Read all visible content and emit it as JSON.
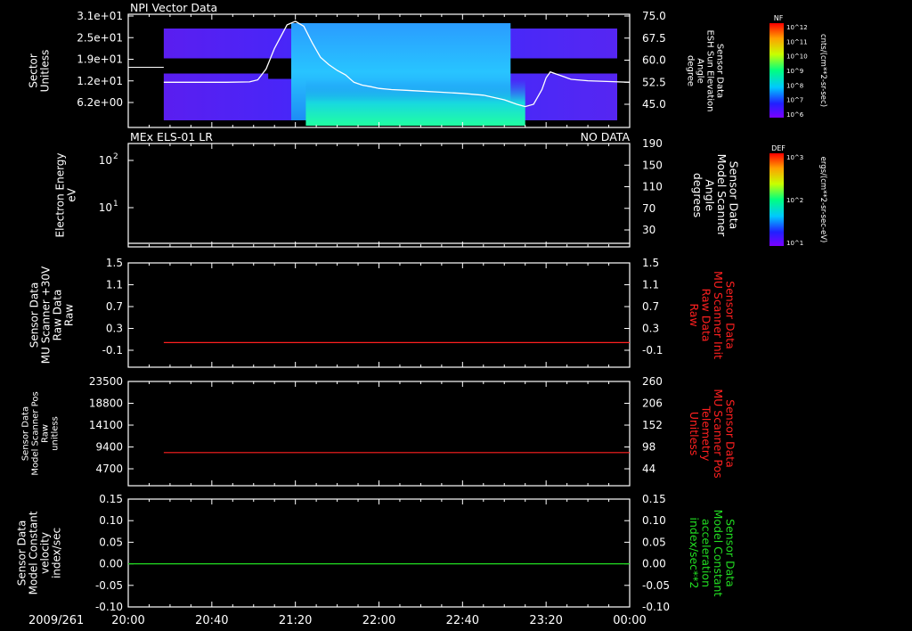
{
  "colors": {
    "background": "#000000",
    "foreground": "#ffffff",
    "red": "#ff2020",
    "green": "#22dd22"
  },
  "time_axis": {
    "date": "2009/261",
    "ticks": [
      "20:00",
      "20:40",
      "21:20",
      "22:00",
      "22:40",
      "23:20",
      "00:00"
    ],
    "minutes": [
      0,
      40,
      80,
      120,
      160,
      200,
      240
    ]
  },
  "colorbars": [
    {
      "title": "NF",
      "unit": "cnts/(cm**2-sr-sec)",
      "ticks": [
        "10^12",
        "10^11",
        "10^10",
        "10^9",
        "10^8",
        "10^7",
        "10^6"
      ]
    },
    {
      "title": "DEF",
      "unit": "ergs/(cm**2-sr-sec-eV)",
      "ticks": [
        "10^3",
        "10^2",
        "10^1"
      ]
    }
  ],
  "chart_data": [
    {
      "type": "heatmap",
      "title": "NPI Vector Data",
      "ylabel_lines": [
        "Sector",
        "Unitless"
      ],
      "yticks": [
        "3.1e+01",
        "2.5e+01",
        "1.9e+01",
        "1.2e+01",
        "6.2e+00"
      ],
      "right_ylabel_lines": [
        "Sensor Data",
        "ESH Sun Elevation",
        "Angle",
        "degree"
      ],
      "right_yticks": [
        "75.0",
        "67.5",
        "60.0",
        "52.5",
        "45.0"
      ],
      "right_ylim": [
        41,
        75
      ],
      "data_start_min": 17,
      "white_line": {
        "t": [
          17,
          47,
          58,
          62,
          66,
          70,
          76,
          80,
          84,
          88,
          92,
          96,
          100,
          104,
          108,
          112,
          116,
          120,
          126,
          132,
          140,
          150,
          160,
          170,
          180,
          186,
          190,
          194,
          198,
          200,
          202,
          206,
          212,
          220,
          232,
          240
        ],
        "v": [
          52.5,
          52.5,
          52.6,
          53.3,
          57,
          64,
          72,
          73.2,
          71.5,
          66,
          61,
          58.5,
          56.5,
          55,
          52.5,
          51.5,
          51,
          50.4,
          50,
          49.8,
          49.5,
          49.1,
          48.7,
          48.1,
          46.5,
          45,
          44.2,
          45,
          50,
          54,
          56,
          55,
          53.5,
          53,
          52.7,
          52.5
        ]
      }
    },
    {
      "type": "line",
      "title": "MEx ELS-01 LR",
      "status": "NO DATA",
      "ylabel_lines": [
        "Electron Energy",
        "eV"
      ],
      "ytick_major": [
        "10",
        "10"
      ],
      "ytick_exp": [
        "2",
        "1"
      ],
      "right_ylabel_lines": [
        "Sensor Data",
        "Model Scanner",
        "Angle",
        "degrees"
      ],
      "right_yticks": [
        "190",
        "150",
        "110",
        "70",
        "30"
      ],
      "right_ylim": [
        0,
        190
      ],
      "series": [
        {
          "values": [
            {
              "t": 0,
              "v": 10
            },
            {
              "t": 240,
              "v": 10
            }
          ]
        }
      ]
    },
    {
      "type": "line",
      "ylabel_lines": [
        "Sensor Data",
        "MU Scanner +30V",
        "Raw Data",
        "Raw"
      ],
      "yticks": [
        "1.5",
        "1.1",
        "0.7",
        "0.3",
        "-0.1"
      ],
      "ylim": [
        -0.35,
        1.5
      ],
      "right_ylabel_lines": [
        "Sensor Data",
        "MU Scanner Init",
        "Raw Data",
        "Raw"
      ],
      "right_yticks": [
        "1.5",
        "1.1",
        "0.7",
        "0.3",
        "-0.1"
      ],
      "series": [
        {
          "values": [
            {
              "t": 17,
              "v": 0.04
            },
            {
              "t": 240,
              "v": 0.04
            }
          ]
        }
      ]
    },
    {
      "type": "line",
      "ylabel_lines": [
        "Sensor Data",
        "Model Scanner Pos",
        "Raw",
        "unitless"
      ],
      "yticks": [
        "23500",
        "18800",
        "14100",
        "9400",
        "4700"
      ],
      "ylim": [
        0,
        23500
      ],
      "right_ylabel_lines": [
        "Sensor Data",
        "MU Scanner Pos",
        "Telemetry",
        "Unitless"
      ],
      "right_yticks": [
        "260",
        "206",
        "152",
        "98",
        "44"
      ],
      "series": [
        {
          "values": [
            {
              "t": 17,
              "v": 8200
            },
            {
              "t": 240,
              "v": 8200
            }
          ]
        }
      ]
    },
    {
      "type": "line",
      "ylabel_lines": [
        "Sensor Data",
        "Model Constant",
        "velocity",
        "index/sec"
      ],
      "yticks": [
        "0.15",
        "0.10",
        "0.05",
        "0.00",
        "-0.05",
        "-0.10"
      ],
      "ylim": [
        -0.1,
        0.15
      ],
      "right_ylabel_lines": [
        "Sensor Data",
        "Model Constant",
        "acceleration",
        "index/sec**2"
      ],
      "right_yticks": [
        "0.15",
        "0.10",
        "0.05",
        "0.00",
        "-0.05",
        "-0.10"
      ],
      "series": [
        {
          "values": [
            {
              "t": 0,
              "v": 0
            },
            {
              "t": 240,
              "v": 0
            }
          ]
        }
      ]
    }
  ]
}
